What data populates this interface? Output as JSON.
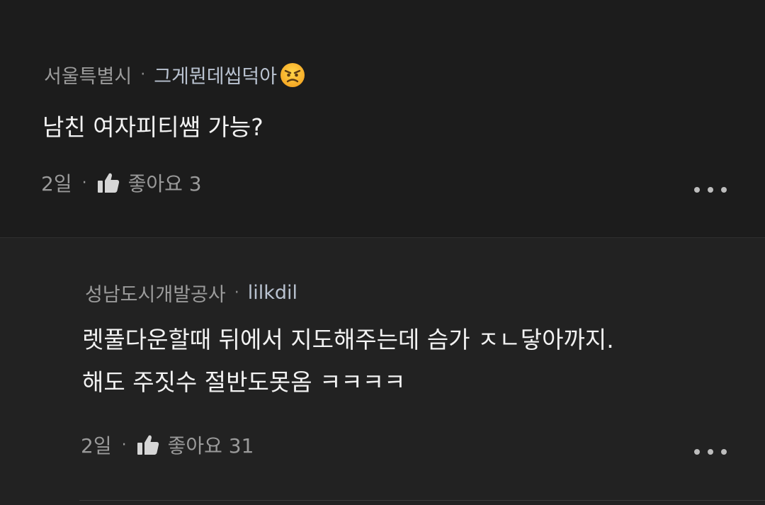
{
  "comments": [
    {
      "location": "서울특별시",
      "nickname": "그게뭔데씹덕아",
      "badge_icon": "angry-face-emoji",
      "text_lines": [
        "남친 여자피티쌤 가능?"
      ],
      "age": "2일",
      "like_label": "좋아요 3"
    },
    {
      "location": "성남도시개발공사",
      "nickname": "lilkdil",
      "text_lines": [
        "렛풀다운할때 뒤에서 지도해주는데 슴가 ㅈㄴ닿아까지.",
        "해도 주짓수 절반도못옴 ㅋㅋㅋㅋ"
      ],
      "age": "2일",
      "like_label": "좋아요 31"
    }
  ],
  "separator": "·",
  "colors": {
    "background": "#1f1f1f",
    "meta_text": "#9b9b9b",
    "nickname_text": "#b9c2d0",
    "body_text": "#f2f2f2"
  }
}
